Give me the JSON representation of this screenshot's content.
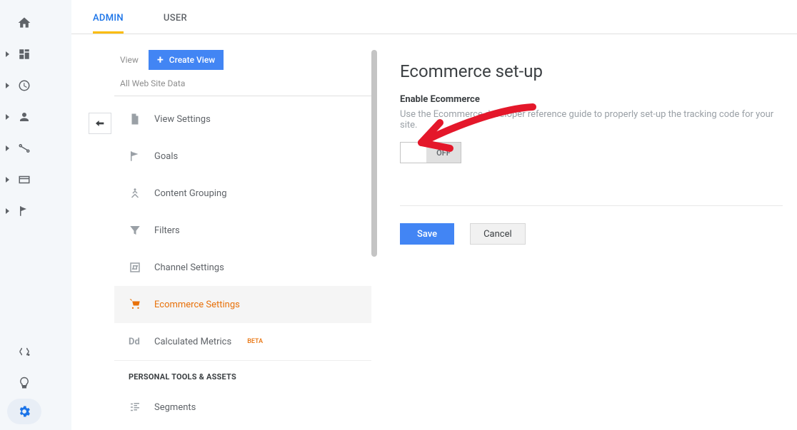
{
  "rail": {
    "items": [
      "home",
      "dashboard",
      "clock",
      "user",
      "flow",
      "card",
      "flag"
    ],
    "bottom": [
      "path",
      "bulb",
      "gear"
    ]
  },
  "tabs": {
    "admin": "ADMIN",
    "user": "USER"
  },
  "panel": {
    "view_label": "View",
    "create_label": "Create View",
    "all_data": "All Web Site Data",
    "items": [
      {
        "label": "View Settings",
        "icon": "file"
      },
      {
        "label": "Goals",
        "icon": "flag"
      },
      {
        "label": "Content Grouping",
        "icon": "group"
      },
      {
        "label": "Filters",
        "icon": "filter"
      },
      {
        "label": "Channel Settings",
        "icon": "channel"
      },
      {
        "label": "Ecommerce Settings",
        "icon": "cart",
        "active": true
      },
      {
        "label": "Calculated Metrics",
        "icon": "dd",
        "beta": "BETA"
      }
    ],
    "section_head": "PERSONAL TOOLS & ASSETS",
    "segments": "Segments"
  },
  "main": {
    "title": "Ecommerce set-up",
    "subhead": "Enable Ecommerce",
    "desc": "Use the Ecommerce developer reference guide to properly set-up the tracking code for your site.",
    "toggle_off": "OFF",
    "save": "Save",
    "cancel": "Cancel"
  }
}
